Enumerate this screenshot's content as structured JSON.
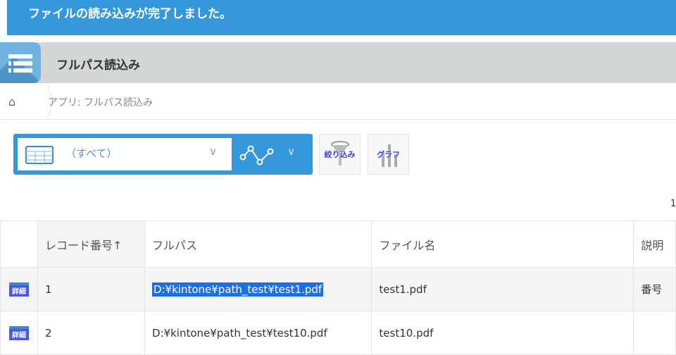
{
  "notification": {
    "message": "ファイルの読み込みが完了しました。",
    "color": "#3498db"
  },
  "app": {
    "title": "フルパス読込み",
    "icon": "list-icon"
  },
  "breadcrumb": {
    "home_icon": "home-icon",
    "path": "アプリ: フルパス読込み"
  },
  "toolbar": {
    "view_label": "（すべて）",
    "view_icon": "table-icon",
    "graph_icon": "line-graph-icon",
    "filter_label": "絞り込み",
    "graph_label": "グラフ"
  },
  "pagination": {
    "text": "1"
  },
  "table": {
    "columns": [
      "",
      "レコード番号↑",
      "フルパス",
      "ファイル名",
      "説明"
    ],
    "detail_label": "詳細",
    "rows": [
      {
        "id": "1",
        "path": "D:¥kintone¥path_test¥test1.pdf",
        "file": "test1.pdf",
        "desc": "番号"
      },
      {
        "id": "2",
        "path": "D:¥kintone¥path_test¥test10.pdf",
        "file": "test10.pdf",
        "desc": ""
      }
    ]
  }
}
